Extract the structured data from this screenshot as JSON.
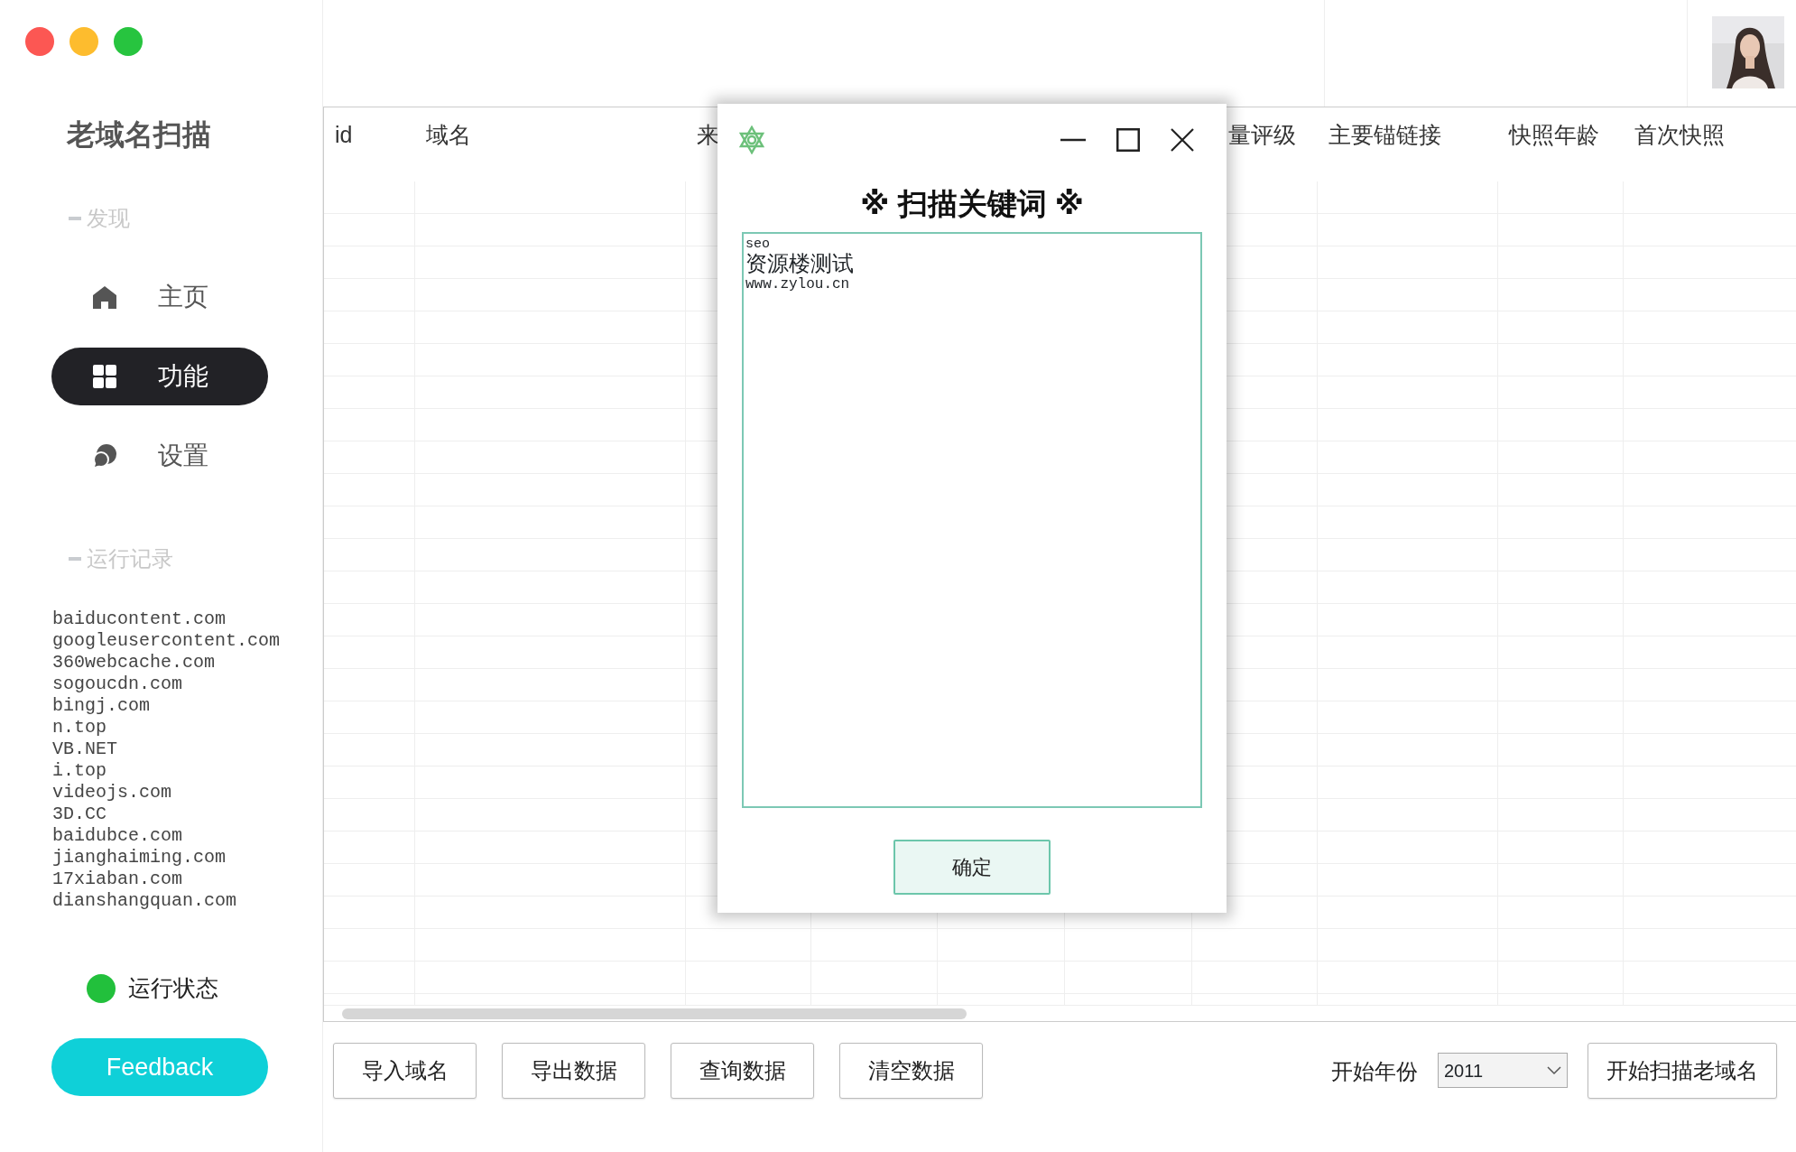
{
  "window": {
    "controls": [
      {
        "color": "#fc5753"
      },
      {
        "color": "#fdbc2e"
      },
      {
        "color": "#27c43f"
      }
    ]
  },
  "sidebar": {
    "title": "老域名扫描",
    "discover_heading": "发现",
    "nav": [
      {
        "label": "主页",
        "selected": false
      },
      {
        "label": "功能",
        "selected": true
      },
      {
        "label": "设置",
        "selected": false
      }
    ],
    "log_heading": "运行记录",
    "log": [
      "baiducontent.com",
      "googleusercontent.com",
      "360webcache.com",
      "sogoucdn.com",
      "bingj.com",
      "n.top",
      "VB.NET",
      "i.top",
      "videojs.com",
      "3D.CC",
      "baidubce.com",
      "jianghaiming.com",
      "17xiaban.com",
      "dianshangquan.com"
    ],
    "status": {
      "label": "运行状态",
      "on": true
    },
    "feedback": "Feedback"
  },
  "table": {
    "columns": [
      {
        "label": "id"
      },
      {
        "label": "域名"
      },
      {
        "label": "来"
      },
      {
        "label": "量评级"
      },
      {
        "label": "主要锚链接"
      },
      {
        "label": "快照年龄"
      },
      {
        "label": "首次快照"
      }
    ]
  },
  "toolbar": {
    "buttons": [
      "导入域名",
      "导出数据",
      "查询数据",
      "清空数据"
    ],
    "year_label": "开始年份",
    "year_select": {
      "value": "2011"
    },
    "start_button": "开始扫描老域名"
  },
  "dialog": {
    "title": "※ 扫描关键词 ※",
    "keywords": [
      "seo",
      "资源楼测试",
      "www.zylou.cn"
    ],
    "confirm": "确定"
  }
}
